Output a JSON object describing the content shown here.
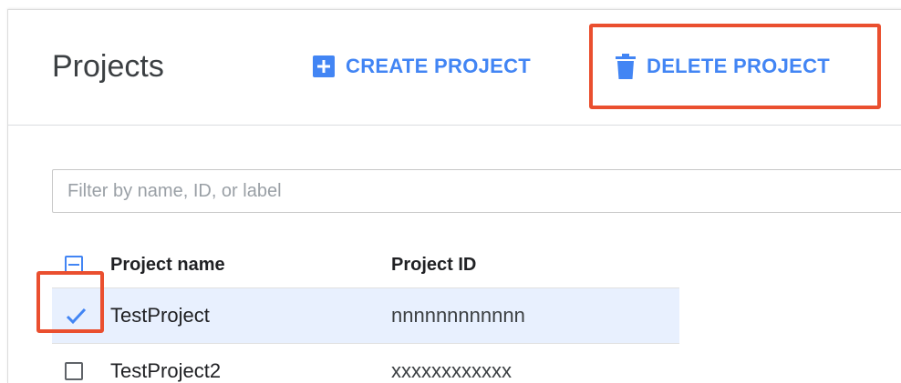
{
  "header": {
    "title": "Projects",
    "create_label": "CREATE PROJECT",
    "delete_label": "DELETE PROJECT"
  },
  "filter": {
    "placeholder": "Filter by name, ID, or label",
    "value": ""
  },
  "table": {
    "columns": [
      "Project name",
      "Project ID"
    ],
    "rows": [
      {
        "name": "TestProject",
        "id": "nnnnnnnnnnnn",
        "selected": true
      },
      {
        "name": "TestProject2",
        "id": "xxxxxxxxxxxx",
        "selected": false
      }
    ]
  },
  "colors": {
    "accent": "#4285f4",
    "highlight": "#ea4f2f",
    "selected_row": "#e8f0fe"
  },
  "icons": {
    "create": "plus-box-icon",
    "delete": "trash-icon",
    "header_checkbox": "indeterminate-checkbox-icon",
    "row_checked": "checkmark-icon"
  }
}
